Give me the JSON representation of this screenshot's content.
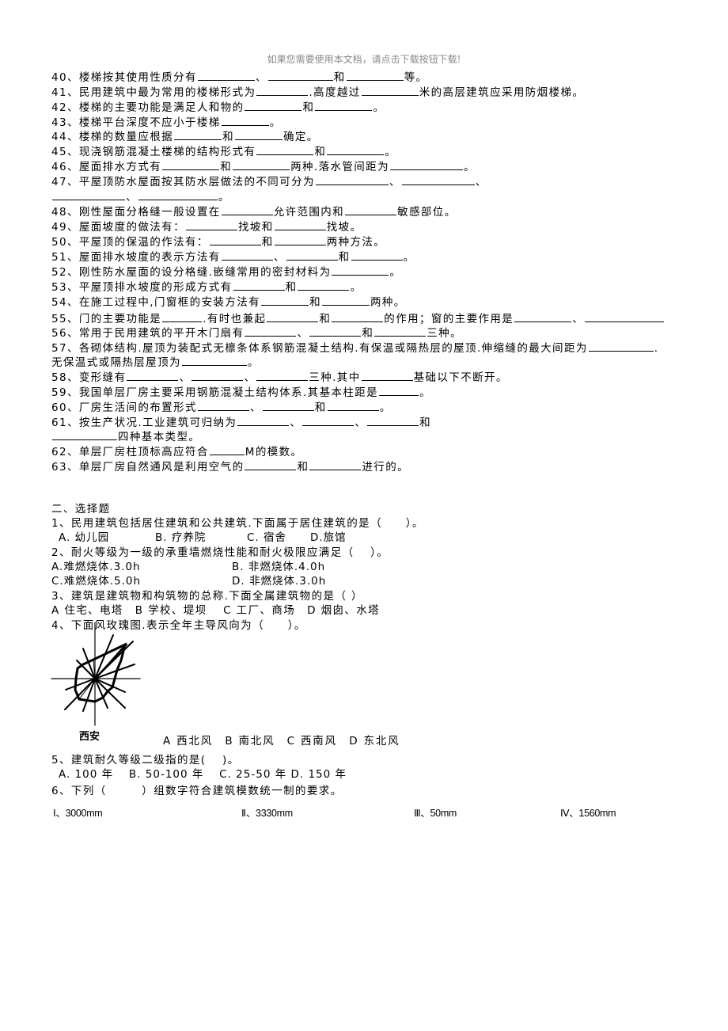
{
  "watermark": "如果您需要使用本文档，请点击下载按钮下载!",
  "fill_in": [
    {
      "id": "q40",
      "parts": [
        "40、楼梯按其使用性质分有",
        "_",
        "、",
        "_",
        "和",
        "_",
        "等。"
      ]
    },
    {
      "id": "q41",
      "parts": [
        "41、民用建筑中最为常用的楼梯形式为",
        "_",
        ".高度越过",
        "_",
        "米的高层建筑应采用防烟楼梯。"
      ]
    },
    {
      "id": "q42",
      "parts": [
        "42、楼梯的主要功能是满足人和物的",
        "_",
        "和",
        "_",
        "。"
      ]
    },
    {
      "id": "q43",
      "parts": [
        "43、楼梯平台深度不应小于楼梯",
        "_",
        "。"
      ]
    },
    {
      "id": "q44",
      "parts": [
        "44、楼梯的数量应根据",
        "_",
        "和",
        "_",
        "确定。"
      ]
    },
    {
      "id": "q45",
      "parts": [
        "45、现浇钢筋混凝土楼梯的结构形式有",
        "_",
        "和",
        "_",
        "。"
      ]
    },
    {
      "id": "q46",
      "parts": [
        "46、屋面排水方式有",
        "_",
        "和",
        "_",
        "两种.落水管间距为",
        "_",
        "。"
      ]
    },
    {
      "id": "q47",
      "parts": [
        "47、平屋顶防水屋面按其防水层做法的不同可分为",
        "_",
        "、",
        "_",
        "、"
      ]
    },
    {
      "id": "q47b",
      "parts": [
        "_",
        "、",
        "_",
        "。"
      ]
    },
    {
      "id": "q48",
      "parts": [
        "48、刚性屋面分格缝一般设置在",
        "_",
        "允许范围内和",
        "_",
        "敏感部位。"
      ]
    },
    {
      "id": "q49",
      "parts": [
        "49、屋面坡度的做法有：",
        "_",
        "找坡和",
        "_",
        "找坡。"
      ]
    },
    {
      "id": "q50",
      "parts": [
        "50、平屋顶的保温的作法有：",
        "_",
        "和",
        "_",
        "两种方法。"
      ]
    },
    {
      "id": "q51",
      "parts": [
        "51、屋面排水坡度的表示方法有",
        "_",
        "、",
        "_",
        "和",
        "_",
        "。"
      ]
    },
    {
      "id": "q52",
      "parts": [
        "52、刚性防水屋面的设分格缝.嵌缝常用的密封材料为",
        "_",
        "。"
      ]
    },
    {
      "id": "q53",
      "parts": [
        "53、平屋顶排水坡度的形成方式有",
        "_",
        "和",
        "_",
        "。"
      ]
    },
    {
      "id": "q54",
      "parts": [
        "54、在施工过程中,门窗框的安装方法有",
        "_",
        "和",
        "_",
        "两种。"
      ]
    },
    {
      "id": "q55",
      "parts": [
        "55、门的主要功能是",
        "_",
        ".有时也兼起",
        "_",
        "和",
        "_",
        "的作用；窗的主要作用是",
        "_",
        "、",
        "_"
      ]
    },
    {
      "id": "q56",
      "parts": [
        "56、常用于民用建筑的平开木门扇有",
        "_",
        "、",
        "_",
        "和",
        "_",
        "三种。"
      ]
    },
    {
      "id": "q57",
      "parts": [
        "57、各砌体结构.屋顶为装配式无檩条体系钢筋混凝土结构.有保温或隔热层的屋顶.伸缩缝的最大间距为",
        "_",
        "."
      ]
    },
    {
      "id": "q57b",
      "parts": [
        "无保温式或隔热层屋顶为",
        "_",
        "。"
      ]
    },
    {
      "id": "q58",
      "parts": [
        "58、变形缝有",
        "_",
        "、",
        "_",
        "、",
        "_",
        "三种.其中",
        "_",
        "基础以下不断开。"
      ]
    },
    {
      "id": "q59",
      "parts": [
        "59、我国单层厂房主要采用钢筋混凝土结构体系.其基本柱距是",
        "_",
        "。"
      ]
    },
    {
      "id": "q60",
      "parts": [
        "60、厂房生活间的布置形式",
        "_",
        "、",
        "_",
        "和",
        "_",
        "。"
      ]
    },
    {
      "id": "q61",
      "parts": [
        "61、按生产状况.工业建筑可归纳为",
        "_",
        "、",
        "_",
        "、",
        "_",
        "和"
      ]
    },
    {
      "id": "q61b",
      "parts": [
        "_",
        "四种基本类型。"
      ]
    },
    {
      "id": "q62",
      "parts": [
        "62、单层厂房柱顶标高应符合",
        "_",
        "M的模数。"
      ]
    },
    {
      "id": "q63",
      "parts": [
        "63、单层厂房自然通风是利用空气的",
        "_",
        "和",
        "_",
        "进行的。"
      ]
    }
  ],
  "section2": {
    "title": "二、选择题",
    "q1": {
      "stem": "1、民用建筑包括居住建筑和公共建筑.下面属于居住建筑的是（　　）。",
      "options": [
        "A. 幼儿园",
        "B. 疗养院",
        "C. 宿舍",
        "D.旅馆"
      ]
    },
    "q2": {
      "stem": "2、耐火等级为一级的承重墙燃烧性能和耐火极限应满足（　 ）。",
      "options": [
        "A.难燃烧体.3.0h",
        "B. 非燃烧体.4.0h",
        "C.难燃烧体.5.0h",
        "D. 非燃烧体.3.0h"
      ]
    },
    "q3": {
      "stem": "3、建筑是建筑物和构筑物的总称.下面全属建筑物的是（ ）",
      "options": "A 住宅、电塔　B 学校、堤坝　 C 工厂、商场　D 烟囱、水塔"
    },
    "q4": {
      "stem": "4、下面风玫瑰图.表示全年主导风向为（　　）。",
      "figure_label": "西安",
      "options": "A 西北风　B 南北风　C 西南风　D 东北风"
    },
    "q5": {
      "stem": "5、建筑耐久等级二级指的是(　 )。",
      "options": "A. 100 年　 B. 50-100 年　 C. 25-50 年 D. 150 年"
    },
    "q6": {
      "stem": "6、下列（　　　）组数字符合建筑模数统一制的要求。",
      "options": [
        "Ⅰ、3000mm",
        "Ⅱ、3330mm",
        "Ⅲ、50mm",
        "Ⅳ、1560mm"
      ]
    }
  }
}
